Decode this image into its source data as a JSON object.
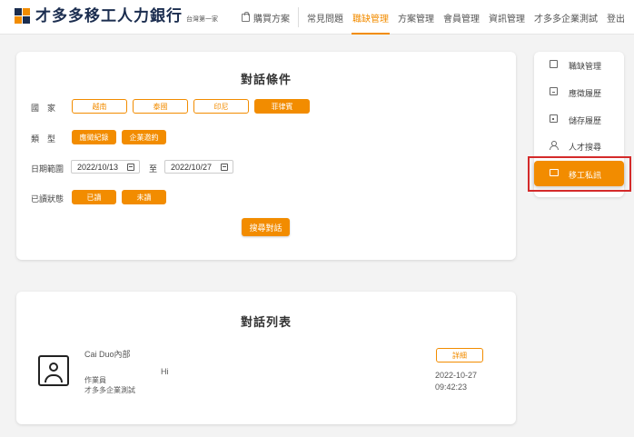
{
  "header": {
    "logo_text": "才多多移工人力銀行",
    "logo_sub": "台灣第一家",
    "nav": [
      {
        "label": "購買方案",
        "active": false
      },
      {
        "label": "常見問題",
        "active": false
      },
      {
        "label": "職缺管理",
        "active": true
      },
      {
        "label": "方案管理",
        "active": false
      },
      {
        "label": "會員管理",
        "active": false
      },
      {
        "label": "資訊管理",
        "active": false
      },
      {
        "label": "才多多企業測試",
        "active": false
      },
      {
        "label": "登出",
        "active": false
      }
    ]
  },
  "filters": {
    "title": "對話條件",
    "country_label": "國　家",
    "countries": [
      "越南",
      "泰國",
      "印尼",
      "菲律賓"
    ],
    "type_label": "類　型",
    "types": [
      "應徵紀錄",
      "企業邀約"
    ],
    "date_label": "日期範圍",
    "date_from": "2022/10/13",
    "date_sep": "至",
    "date_to": "2022/10/27",
    "read_label": "已讀狀態",
    "read_states": [
      "已讀",
      "未讀"
    ],
    "search_button": "搜尋對話"
  },
  "list": {
    "title": "對話列表",
    "items": [
      {
        "name": "Cai Duo內部",
        "role": "作業員",
        "company": "才多多企業測試",
        "message": "Hi",
        "detail_button": "詳細",
        "date": "2022-10-27",
        "time": "09:42:23"
      }
    ]
  },
  "sidebar": {
    "items": [
      {
        "label": "職缺管理",
        "icon": "briefcase-icon"
      },
      {
        "label": "應徵履歷",
        "icon": "resume-icon"
      },
      {
        "label": "儲存履歷",
        "icon": "saved-resume-icon"
      },
      {
        "label": "人才搜尋",
        "icon": "talent-search-icon"
      }
    ],
    "active_item": {
      "label": "移工私訊",
      "icon": "chat-icon"
    }
  },
  "colors": {
    "accent": "#f28c00",
    "brand_dark": "#1b2d4f",
    "highlight_frame": "#d42a2a"
  }
}
